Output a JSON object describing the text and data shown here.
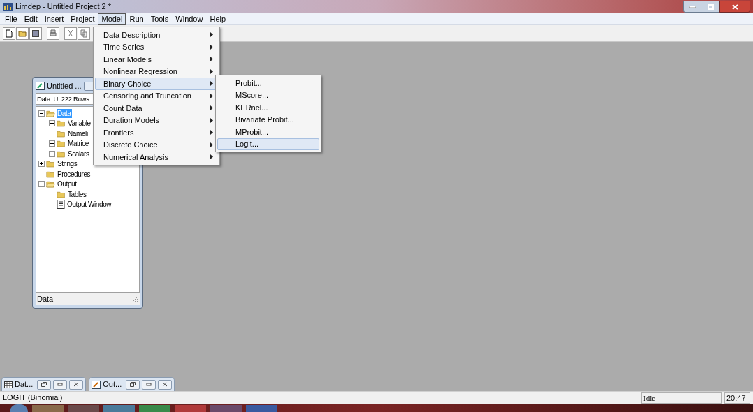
{
  "window": {
    "title": "Limdep - Untitled Project 2 *"
  },
  "menubar": [
    {
      "label": "File",
      "selected": false
    },
    {
      "label": "Edit",
      "selected": false
    },
    {
      "label": "Insert",
      "selected": false
    },
    {
      "label": "Project",
      "selected": false
    },
    {
      "label": "Model",
      "selected": true
    },
    {
      "label": "Run",
      "selected": false
    },
    {
      "label": "Tools",
      "selected": false
    },
    {
      "label": "Window",
      "selected": false
    },
    {
      "label": "Help",
      "selected": false
    }
  ],
  "model_menu": [
    {
      "label": "Data Description",
      "selected": false
    },
    {
      "label": "Time Series",
      "selected": false
    },
    {
      "label": "Linear Models",
      "selected": false
    },
    {
      "label": "Nonlinear Regression",
      "selected": false
    },
    {
      "label": "Binary Choice",
      "selected": true
    },
    {
      "label": "Censoring and Truncation",
      "selected": false
    },
    {
      "label": "Count Data",
      "selected": false
    },
    {
      "label": "Duration Models",
      "selected": false
    },
    {
      "label": "Frontiers",
      "selected": false
    },
    {
      "label": "Discrete Choice",
      "selected": false
    },
    {
      "label": "Numerical Analysis",
      "selected": false
    }
  ],
  "submenu": [
    {
      "label": "Probit...",
      "selected": false
    },
    {
      "label": "MScore...",
      "selected": false
    },
    {
      "label": "KERnel...",
      "selected": false
    },
    {
      "label": "Bivariate Probit...",
      "selected": false
    },
    {
      "label": "MProbit...",
      "selected": false
    },
    {
      "label": "Logit...",
      "selected": true
    }
  ],
  "child_window": {
    "title": "Untitled ...",
    "data_field": "Data: U; 222 Rows:",
    "status": "Data",
    "tree": [
      {
        "label": "Data",
        "kind": "folder",
        "expandable": true,
        "expanded": true,
        "selected": true,
        "children": [
          {
            "label": "Variable",
            "kind": "folder",
            "expandable": true,
            "expanded": false,
            "selected": false
          },
          {
            "label": "Nameli",
            "kind": "folder",
            "expandable": false,
            "selected": false
          },
          {
            "label": "Matrice",
            "kind": "folder",
            "expandable": true,
            "expanded": false,
            "selected": false
          },
          {
            "label": "Scalars",
            "kind": "folder",
            "expandable": true,
            "expanded": false,
            "selected": false
          }
        ]
      },
      {
        "label": "Strings",
        "kind": "folder",
        "expandable": true,
        "expanded": false,
        "selected": false
      },
      {
        "label": "Procedures",
        "kind": "folder",
        "expandable": false,
        "selected": false
      },
      {
        "label": "Output",
        "kind": "folder",
        "expandable": true,
        "expanded": true,
        "selected": false,
        "children": [
          {
            "label": "Tables",
            "kind": "folder",
            "expandable": false,
            "selected": false
          },
          {
            "label": "Output Window",
            "kind": "document",
            "expandable": false,
            "selected": false
          }
        ]
      }
    ]
  },
  "window_tabs": [
    {
      "label": "Dat...",
      "kind": "grid"
    },
    {
      "label": "Out...",
      "kind": "output"
    }
  ],
  "status_bar": {
    "message": "LOGIT (Binomial)",
    "state": "Idle",
    "time": "20:47"
  }
}
